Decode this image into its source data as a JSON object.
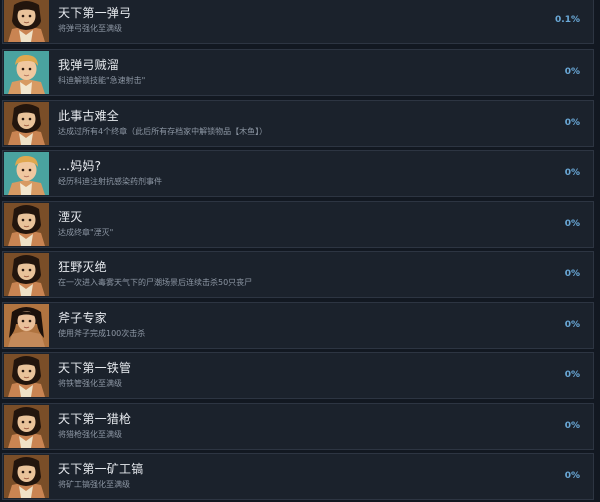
{
  "achievements": [
    {
      "title": "天下第一弹弓",
      "desc": "将弹弓强化至满级",
      "percent": "0.1%",
      "icon": "portrait-dark-hair-avatar"
    },
    {
      "title": "我弹弓贼溜",
      "desc": "科迪解锁技能\"急速射击\"",
      "percent": "0%",
      "icon": "portrait-blonde-boy-avatar"
    },
    {
      "title": "此事古难全",
      "desc": "达成过所有4个终章（此后所有存档家中解锁物品【木鱼】）",
      "percent": "0%",
      "icon": "portrait-dark-hair-avatar"
    },
    {
      "title": "…妈妈?",
      "desc": "经历科迪注射抗感染药剂事件",
      "percent": "0%",
      "icon": "portrait-blonde-boy-avatar"
    },
    {
      "title": "湮灭",
      "desc": "达成终章\"湮灭\"",
      "percent": "0%",
      "icon": "portrait-dark-hair-avatar"
    },
    {
      "title": "狂野灭绝",
      "desc": "在一次进入毒雾天气下的尸潮场景后连续击杀50只丧尸",
      "percent": "0%",
      "icon": "portrait-dark-hair-avatar"
    },
    {
      "title": "斧子专家",
      "desc": "使用斧子完成100次击杀",
      "percent": "0%",
      "icon": "portrait-woman-avatar"
    },
    {
      "title": "天下第一铁管",
      "desc": "将铁管强化至满级",
      "percent": "0%",
      "icon": "portrait-dark-hair-avatar"
    },
    {
      "title": "天下第一猎枪",
      "desc": "将猎枪强化至满级",
      "percent": "0%",
      "icon": "portrait-dark-hair-avatar"
    },
    {
      "title": "天下第一矿工镐",
      "desc": "将矿工镐强化至满级",
      "percent": "0%",
      "icon": "portrait-dark-hair-avatar"
    }
  ]
}
